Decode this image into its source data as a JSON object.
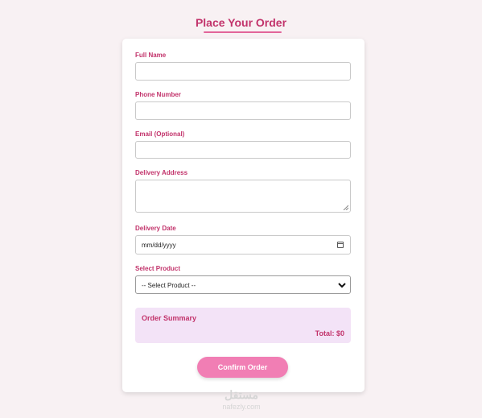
{
  "form": {
    "title": "Place Your Order",
    "fields": {
      "full_name": {
        "label": "Full Name",
        "value": ""
      },
      "phone": {
        "label": "Phone Number",
        "value": ""
      },
      "email": {
        "label": "Email (Optional)",
        "value": ""
      },
      "address": {
        "label": "Delivery Address",
        "value": ""
      },
      "date": {
        "label": "Delivery Date",
        "placeholder": "mm/dd/yyyy"
      },
      "product": {
        "label": "Select Product",
        "selected": "-- Select Product --"
      }
    },
    "summary": {
      "title": "Order Summary",
      "total": "Total: $0"
    },
    "confirm_label": "Confirm Order"
  },
  "watermark": {
    "logo": "مستقل",
    "site": "nafezly.com"
  },
  "colors": {
    "page_bg": "#f8f1f3",
    "accent": "#c2336b",
    "button": "#f17eb4",
    "summary_bg": "#f3e3f7"
  }
}
